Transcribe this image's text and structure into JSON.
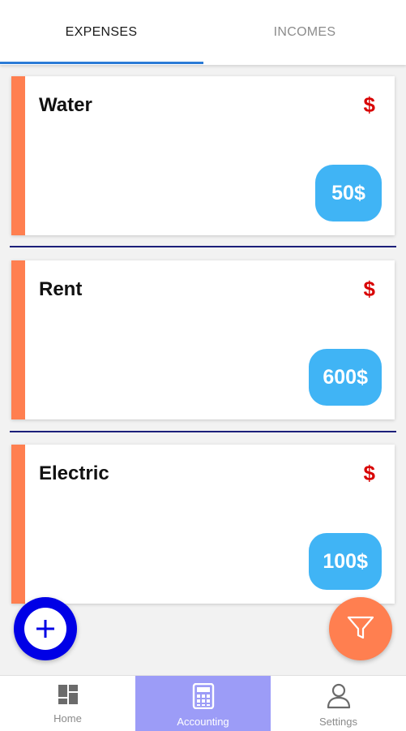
{
  "colors": {
    "accent_blue": "#2b7bd6",
    "stripe_orange": "#ff7f50",
    "currency_red": "#d80000",
    "pill_blue": "#40b4f5",
    "divider_navy": "#1b1f7a",
    "fab_add_blue": "#0000e6",
    "fab_filter_orange": "#ff7f50",
    "nav_active_bg": "#9c9cf7"
  },
  "tabs": [
    {
      "label": "EXPENSES",
      "active": true
    },
    {
      "label": "INCOMES",
      "active": false
    }
  ],
  "expenses": [
    {
      "title": "Water",
      "currency": "$",
      "amount": "50$"
    },
    {
      "title": "Rent",
      "currency": "$",
      "amount": "600$"
    },
    {
      "title": "Electric",
      "currency": "$",
      "amount": "100$"
    }
  ],
  "fab": {
    "add_icon": "plus-icon",
    "filter_icon": "filter-icon"
  },
  "bottom_nav": {
    "items": [
      {
        "label": "Home",
        "icon": "dashboard-icon",
        "active": false
      },
      {
        "label": "Accounting",
        "icon": "calculator-icon",
        "active": true
      },
      {
        "label": "Settings",
        "icon": "user-icon",
        "active": false
      }
    ]
  }
}
